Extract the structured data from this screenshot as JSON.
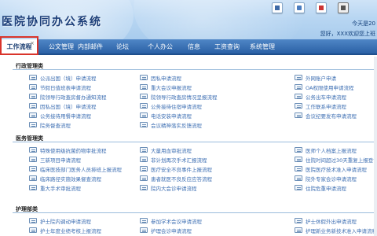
{
  "header": {
    "title": "医院协同办公系统",
    "date": "今天是20",
    "welcome": "您好，XXX欢迎您上班"
  },
  "nav": {
    "items": [
      {
        "label": "工作流程",
        "active": true
      },
      {
        "label": "公文管理"
      },
      {
        "label": "内部邮件"
      },
      {
        "label": "论坛"
      },
      {
        "label": "个人办公"
      },
      {
        "label": "信息"
      },
      {
        "label": "工资查询"
      },
      {
        "label": "系统管理"
      }
    ],
    "close_glyph": "×"
  },
  "sections": [
    {
      "title": "行政管理类",
      "items": [
        [
          "公派出国（境）申请流程",
          "因私申请流程",
          "外网账户申请"
        ],
        [
          "节假日值班表申请流程",
          "重大会议申报流程",
          "OA权限使用申请流程"
        ],
        [
          "院领导行政查房督办通知流程",
          "院领导行政查房情况呈报流程",
          "公务出车申请流程"
        ],
        [
          "因私出国（境）申请流程",
          "公务接待住宿申请流程",
          "工作联系申请流程"
        ],
        [
          "公务接待用餐申请流程",
          "电话安装申请流程",
          "会议纪要发布申请流程"
        ],
        [
          "院务督查流程",
          "会议精神落实反馈流程",
          ""
        ]
      ]
    },
    {
      "title": "医务管理类",
      "items": [
        [
          "特殊使用级抗菌药物审批流程",
          "大量用血审批流程",
          "医师个人档案上报流程"
        ],
        [
          "三新项目申请流程",
          "非计划再次手术汇报流程",
          "住院时间超过30天重复上报登记流程"
        ],
        [
          "临床医技部门医务人员排班上报流程",
          "医疗安全不良事件上报流程",
          "医院医疗技术准入申请流程"
        ],
        [
          "临床路径实施效果督查流程",
          "患者就医不良反应应答流程",
          "院外专家会诊申请流程"
        ],
        [
          "重大手术审批流程",
          "院内大会诊申请流程",
          "住院危重申请流程"
        ]
      ]
    },
    {
      "title": "护理部类",
      "items": [
        [
          "护士院内调动申请流程",
          "参加学术会议申请流程",
          "护士休假外出申请流程"
        ],
        [
          "护士年度业绩考核上报流程",
          "护理会诊申请流程",
          "护理新业务新技术准入申请流程"
        ]
      ]
    }
  ],
  "colors": {
    "nav_bg": "#2a61a5",
    "active_outline": "#d9342b",
    "link": "#3e6fb3",
    "title": "#1d3f79"
  }
}
